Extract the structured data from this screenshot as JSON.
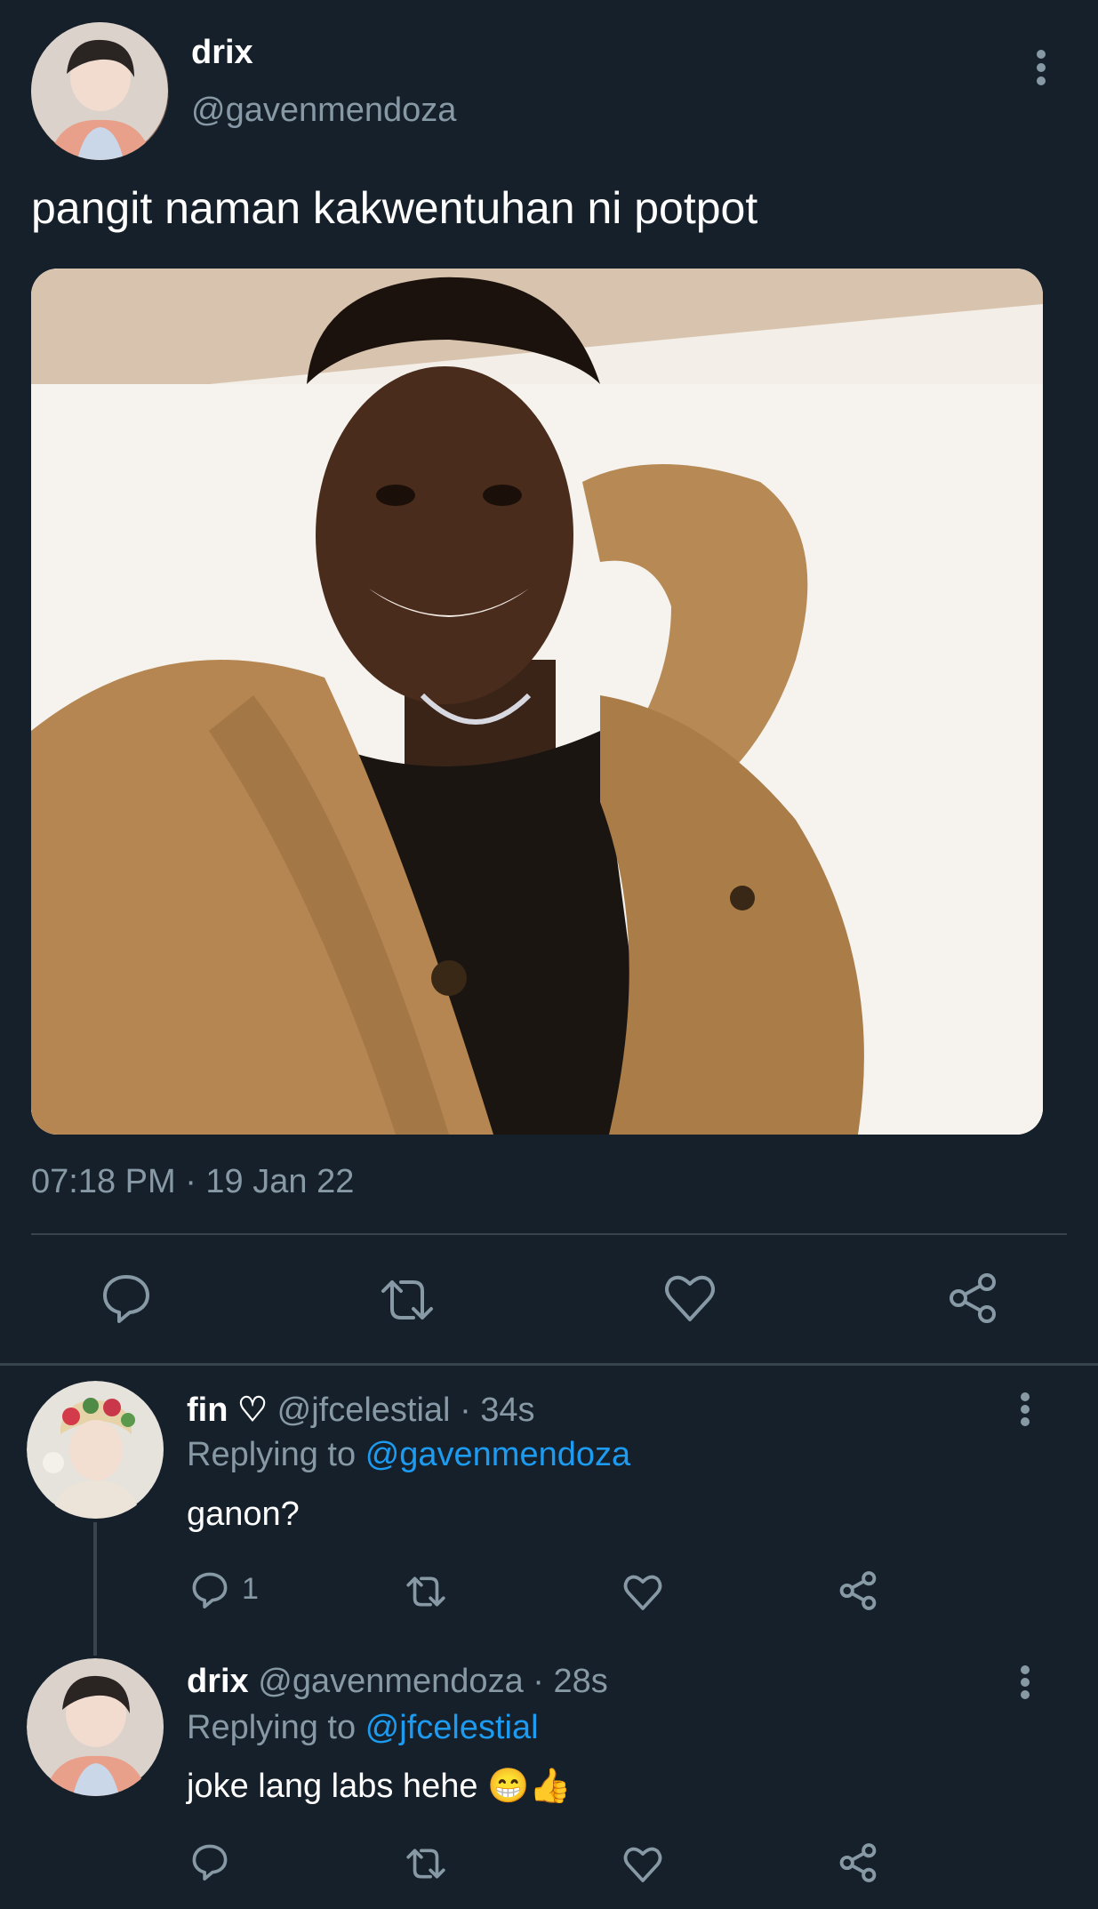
{
  "main_tweet": {
    "display_name": "drix",
    "handle": "@gavenmendoza",
    "text": "pangit naman kakwentuhan ni potpot",
    "timestamp": "07:18 PM · 19 Jan 22",
    "image_alt": "photo of a smiling man in a tan coat"
  },
  "replies": [
    {
      "display_name": "fin ♡",
      "handle": "@jfcelestial",
      "time": "· 34s",
      "replying_prefix": "Replying to",
      "replying_to": "@gavenmendoza",
      "text": "ganon?",
      "reply_count": "1"
    },
    {
      "display_name": "drix",
      "handle": "@gavenmendoza",
      "time": "· 28s",
      "replying_prefix": "Replying to",
      "replying_to": "@jfcelestial",
      "text": "joke lang labs hehe",
      "emoji": "😁👍",
      "reply_count": ""
    }
  ],
  "icons": [
    "reply-icon",
    "retweet-icon",
    "like-icon",
    "share-icon",
    "more-icon"
  ],
  "colors": {
    "background": "#15202b",
    "muted": "#8899a6",
    "link": "#1d9bf0",
    "divider": "#38444d"
  }
}
